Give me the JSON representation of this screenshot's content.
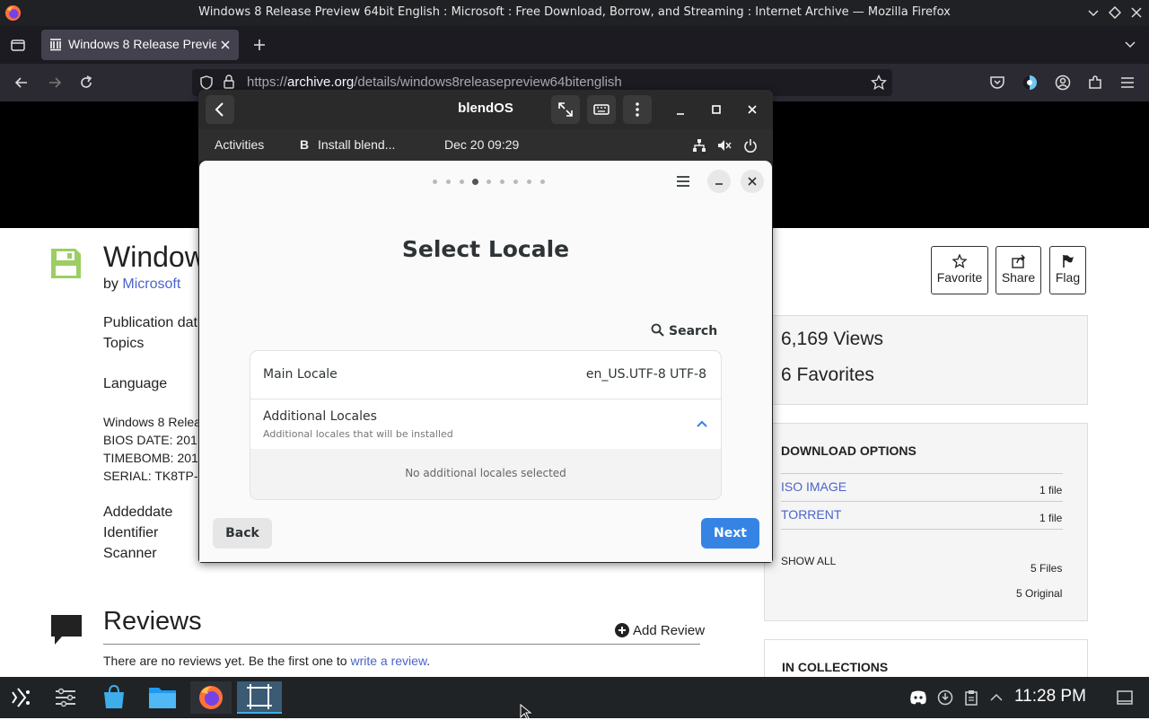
{
  "browser": {
    "window_title": "Windows 8 Release Preview 64bit English : Microsoft : Free Download, Borrow, and Streaming : Internet Archive — Mozilla Firefox",
    "tab_title": "Windows 8 Release Preview",
    "url_prefix": "https://",
    "url_domain": "archive.org",
    "url_path": "/details/windows8releasepreview64bitenglish"
  },
  "archive_page": {
    "title": "Window",
    "by_label": "by",
    "author": "Microsoft",
    "meta_labels": [
      "Publication dat",
      "Topics",
      "Language"
    ],
    "description_lines": [
      "Windows 8 Relea",
      "BIOS DATE: 201",
      "TIMEBOMB: 201",
      "SERIAL: TK8TP-"
    ],
    "meta_labels2": [
      "Addeddate",
      "Identifier",
      "Scanner"
    ],
    "reviews_heading": "Reviews",
    "add_review": "Add Review",
    "no_reviews_text": "There are no reviews yet. Be the first one to",
    "write_review_link": "write a review",
    "period": ".",
    "actions": {
      "favorite": "Favorite",
      "share": "Share",
      "flag": "Flag"
    },
    "views": "6,169 Views",
    "favorites": "6 Favorites",
    "download_heading": "DOWNLOAD OPTIONS",
    "downloads": [
      {
        "label": "ISO IMAGE",
        "count": "1 file"
      },
      {
        "label": "TORRENT",
        "count": "1 file"
      }
    ],
    "show_all": "SHOW ALL",
    "files_count": "5 Files",
    "original_count": "5 Original",
    "collections_heading": "IN COLLECTIONS"
  },
  "vm": {
    "title": "blendOS",
    "gnome_bar": {
      "activities": "Activities",
      "app_letter": "B",
      "app_name": "Install blend...",
      "clock": "Dec 20  09:29"
    },
    "installer": {
      "heading": "Select Locale",
      "search_label": "Search",
      "main_locale_label": "Main Locale",
      "main_locale_value": "en_US.UTF-8 UTF-8",
      "additional_title": "Additional Locales",
      "additional_subtitle": "Additional locales that will be installed",
      "empty_text": "No additional locales selected",
      "back_label": "Back",
      "next_label": "Next",
      "steps_total": 9,
      "step_active": 4
    }
  },
  "taskbar": {
    "clock": "11:28 PM"
  },
  "colors": {
    "accent_blue": "#3584e4",
    "archive_link": "#4b64c9",
    "save_icon_green": "#9cce63"
  }
}
